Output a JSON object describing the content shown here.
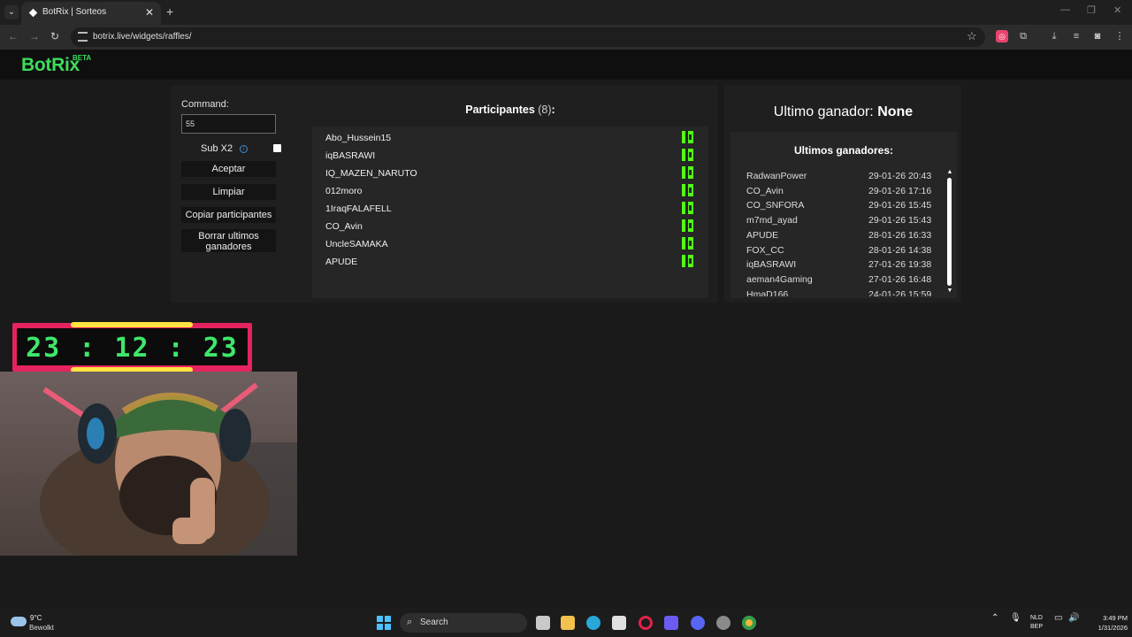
{
  "browser": {
    "tab_title": "BotRix | Sorteos",
    "url": "botrix.live/widgets/raffles/"
  },
  "app": {
    "logo": "BotRix",
    "beta": "BETA"
  },
  "controls": {
    "command_label": "Command:",
    "command_value": "55",
    "sub_label": "Sub X2",
    "sub_checked": false,
    "accept_label": "Aceptar",
    "clear_label": "Limpiar",
    "copy_label": "Copiar participantes",
    "delete_label": "Borrar ultimos ganadores"
  },
  "participants": {
    "title": "Participantes",
    "count": "(8)",
    "colon": ":",
    "items": [
      "Abo_Hussein15",
      "iqBASRAWI",
      "IQ_MAZEN_NARUTO",
      "012moro",
      "1IraqFALAFELL",
      "CO_Avin",
      "UncleSAMAKA",
      "APUDE"
    ]
  },
  "winner": {
    "label": "Ultimo ganador:",
    "value": "None"
  },
  "last_winners": {
    "title": "Ultimos ganadores:",
    "items": [
      {
        "name": "RadwanPower",
        "date": "29-01-26 20:43"
      },
      {
        "name": "CO_Avin",
        "date": "29-01-26 17:16"
      },
      {
        "name": "CO_SNFORA",
        "date": "29-01-26 15:45"
      },
      {
        "name": "m7md_ayad",
        "date": "29-01-26 15:43"
      },
      {
        "name": "APUDE",
        "date": "28-01-26 16:33"
      },
      {
        "name": "FOX_CC",
        "date": "28-01-26 14:38"
      },
      {
        "name": "iqBASRAWI",
        "date": "27-01-26 19:38"
      },
      {
        "name": "aeman4Gaming",
        "date": "27-01-26 16:48"
      },
      {
        "name": "HmaD166",
        "date": "24-01-26 15:59"
      }
    ]
  },
  "timer": "23 : 12 : 23",
  "taskbar": {
    "weather_temp": "9°C",
    "weather_desc": "Bewolkt",
    "search": "Search",
    "lang_top": "NLD",
    "lang_bottom": "BEP",
    "time": "3:49 PM",
    "date": "1/31/2026"
  },
  "colors": {
    "brand": "#3ddc5c",
    "kick": "#53fc18",
    "timer_frame": "#e5245f",
    "timer_accent": "#ffe342"
  }
}
